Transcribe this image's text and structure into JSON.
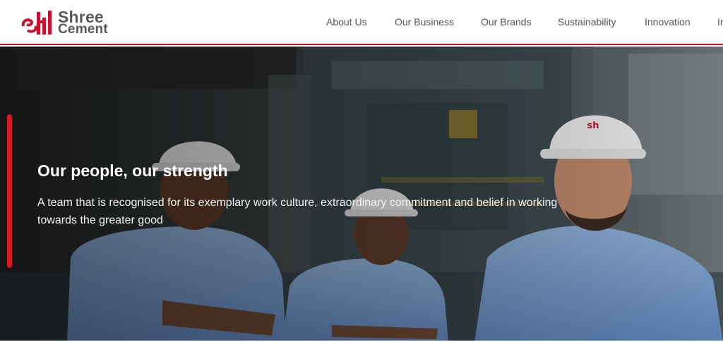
{
  "brand": {
    "line1": "Shree",
    "line2": "Cement",
    "accent_color": "#c8102e",
    "text_color": "#58585a"
  },
  "nav": {
    "items": [
      {
        "label": "About Us"
      },
      {
        "label": "Our Business"
      },
      {
        "label": "Our Brands"
      },
      {
        "label": "Sustainability"
      },
      {
        "label": "Innovation"
      },
      {
        "label": "In"
      }
    ]
  },
  "hero": {
    "title": "Our people, our strength",
    "subtitle": "A team that is recognised for its exemplary work culture, extraordinary commitment and belief in working towards the greater good",
    "accent_color": "#d71920",
    "helmet_badge": "sh"
  }
}
